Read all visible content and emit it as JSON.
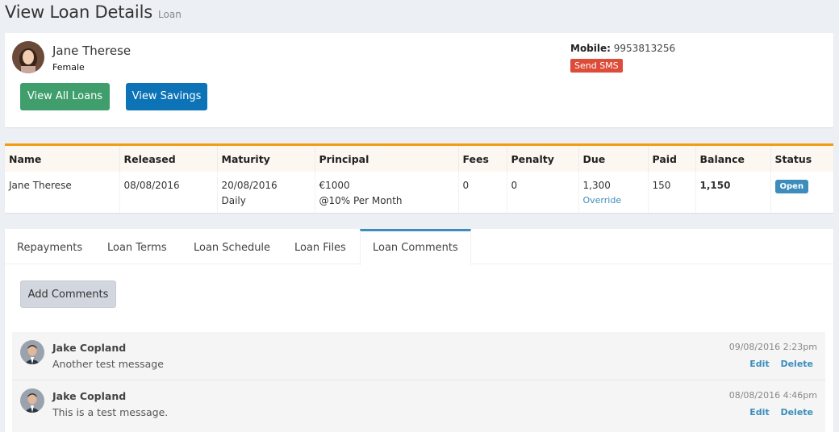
{
  "header": {
    "title": "View Loan Details",
    "subtitle": "Loan"
  },
  "borrower": {
    "name": "Jane Therese",
    "gender": "Female",
    "mobile_label": "Mobile:",
    "mobile": "9953813256",
    "sms_button": "Send SMS",
    "view_loans_button": "View All Loans",
    "view_savings_button": "View Savings"
  },
  "loan_table": {
    "headers": [
      "Name",
      "Released",
      "Maturity",
      "Principal",
      "Fees",
      "Penalty",
      "Due",
      "Paid",
      "Balance",
      "Status"
    ],
    "row": {
      "name": "Jane Therese",
      "released": "08/08/2016",
      "maturity": "20/08/2016",
      "frequency": "Daily",
      "principal": "€1000",
      "interest": "@10% Per Month",
      "fees": "0",
      "penalty": "0",
      "due": "1,300",
      "override": "Override",
      "paid": "150",
      "balance": "1,150",
      "status": "Open"
    }
  },
  "tabs": [
    {
      "label": "Repayments",
      "active": false
    },
    {
      "label": "Loan Terms",
      "active": false
    },
    {
      "label": "Loan Schedule",
      "active": false
    },
    {
      "label": "Loan Files",
      "active": false
    },
    {
      "label": "Loan Comments",
      "active": true
    }
  ],
  "add_comments_button": "Add Comments",
  "comments": [
    {
      "author": "Jake Copland",
      "text": "Another test message",
      "time": "09/08/2016 2:23pm",
      "edit": "Edit",
      "delete": "Delete"
    },
    {
      "author": "Jake Copland",
      "text": "This is a test message.",
      "time": "08/08/2016 4:46pm",
      "edit": "Edit",
      "delete": "Delete"
    }
  ],
  "colors": {
    "accent_orange": "#f39c12",
    "primary_blue": "#0b73b6",
    "success_green": "#3f9e6b",
    "danger_red": "#dd4b39",
    "link_blue": "#3c8dbc"
  }
}
